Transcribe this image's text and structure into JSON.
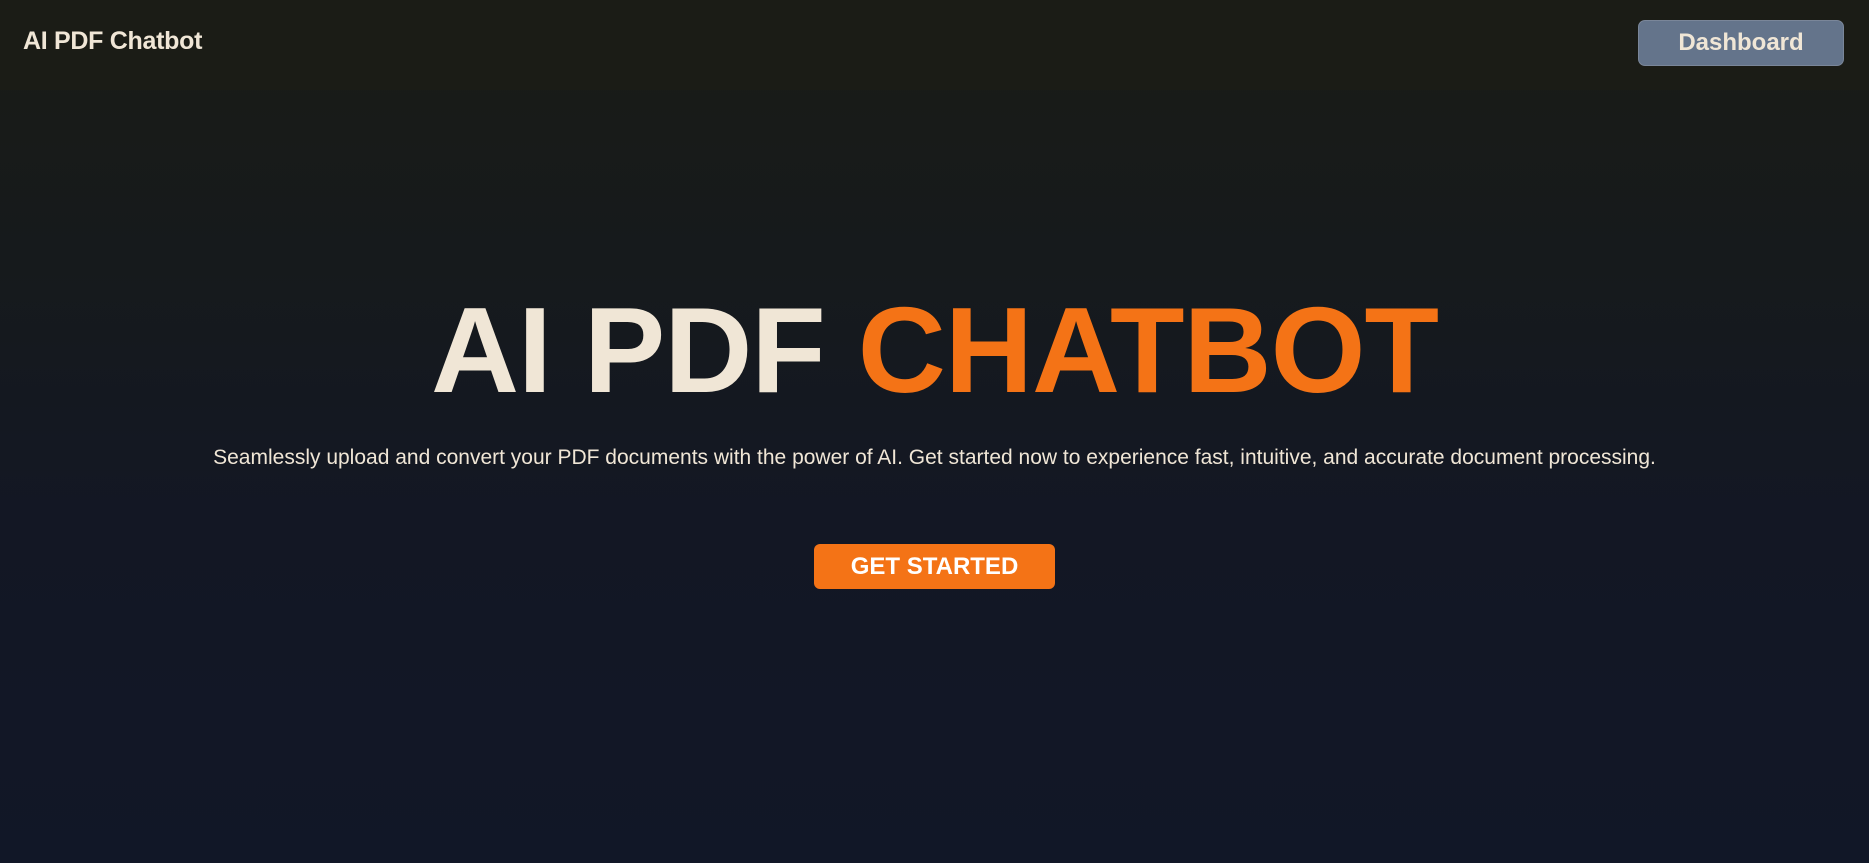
{
  "navbar": {
    "brand": "AI PDF Chatbot",
    "dashboard_label": "Dashboard"
  },
  "hero": {
    "title_primary": "AI PDF ",
    "title_accent": "CHATBOT",
    "subtitle": "Seamlessly upload and convert your PDF documents with the power of AI. Get started now to experience fast, intuitive, and accurate document processing.",
    "cta_label": "GET STARTED"
  },
  "colors": {
    "accent": "#f47316",
    "text": "#f0e6d6",
    "dashboard_button": "#64748b",
    "background_top": "#1a1c16",
    "background_bottom": "#111727"
  }
}
